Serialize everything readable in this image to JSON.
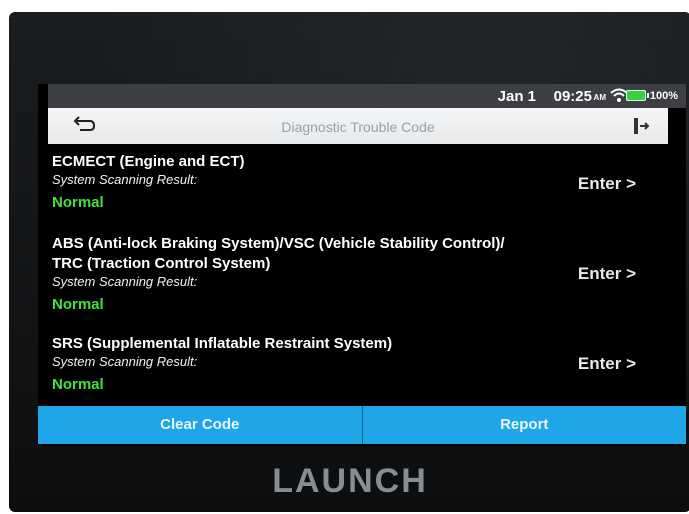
{
  "brand": "LAUNCH",
  "status_bar": {
    "date": "Jan 1",
    "time": "09:25",
    "meridiem": "AM",
    "battery": "100%",
    "battery_color": "#35d23c"
  },
  "header": {
    "back_icon": "back-arrow-icon",
    "title": "Diagnostic Trouble Code",
    "exit_icon": "exit-icon"
  },
  "systems": [
    {
      "name": "ECMECT (Engine and ECT)",
      "scan_label": "System Scanning Result:",
      "result": "Normal",
      "enter_label": "Enter >"
    },
    {
      "name": "ABS (Anti-lock Braking System)/VSC (Vehicle Stability Control)/",
      "name_line2": "TRC (Traction Control System)",
      "scan_label": "System Scanning Result:",
      "result": "Normal",
      "enter_label": "Enter >"
    },
    {
      "name": "SRS (Supplemental Inflatable Restraint System)",
      "scan_label": "System Scanning Result:",
      "result": "Normal",
      "enter_label": "Enter >"
    }
  ],
  "actions": {
    "clear_code": "Clear Code",
    "report": "Report"
  },
  "colors": {
    "accent": "#1ea6e8",
    "normal": "#44e03c"
  }
}
